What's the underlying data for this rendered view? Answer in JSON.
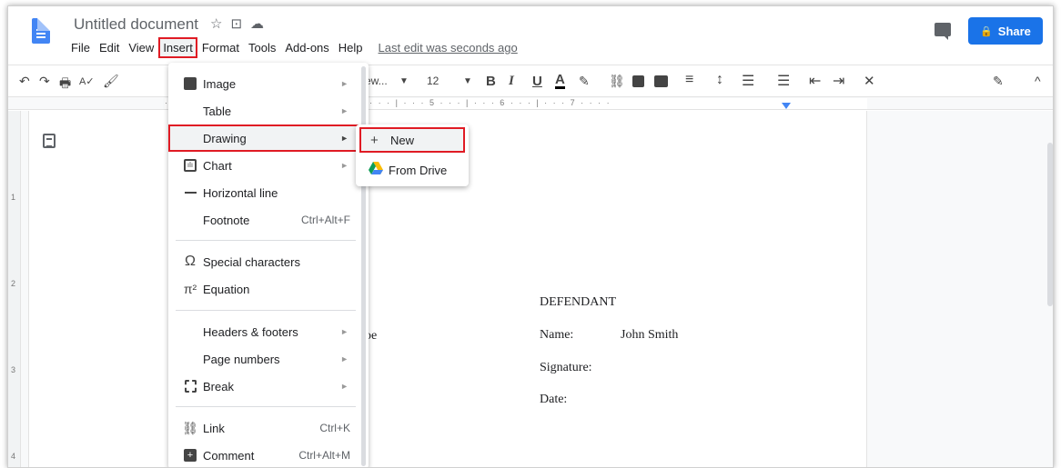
{
  "header": {
    "doc_title": "Untitled document",
    "title_icons": [
      "star-icon",
      "folder-icon",
      "cloud-icon"
    ],
    "menus": [
      "File",
      "Edit",
      "View",
      "Insert",
      "Format",
      "Tools",
      "Add-ons",
      "Help"
    ],
    "last_edit": "Last edit was seconds ago",
    "share_label": "Share",
    "share_icon": "🔒"
  },
  "toolbar": {
    "undo": "↶",
    "redo": "↷",
    "print": "🖶",
    "spell": "A✓",
    "paint": "🖌",
    "font_partial": "ew...",
    "font_size": "12",
    "bold": "B",
    "italic": "I",
    "underline": "U",
    "text_color": "A",
    "highlight": "✎",
    "link": "⛓",
    "edit": "✎",
    "collapse": "^"
  },
  "ruler": {
    "ticks": "· · 1 · · · 2 · · · | · · · 3 · · · | · · · 4 · · · | · · · 5 · · · | · · · 6 · · · | · · · 7 · · · ·"
  },
  "vruler": {
    "marks": [
      "1",
      "2",
      "3",
      "4"
    ]
  },
  "document": {
    "defendant_heading": "DEFENDANT",
    "name_label": "Name:",
    "name_value": "John Smith",
    "signature_label": "Signature:",
    "date_label": "Date:",
    "partial_left": "oe"
  },
  "insert_menu": {
    "items": [
      {
        "label": "Image",
        "icon": "image-icon",
        "submenu": true
      },
      {
        "label": "Table",
        "icon": "",
        "submenu": true
      },
      {
        "label": "Drawing",
        "icon": "",
        "submenu": true
      },
      {
        "label": "Chart",
        "icon": "chart-icon",
        "submenu": true
      },
      {
        "label": "Horizontal line",
        "icon": "horizontal-line-icon",
        "submenu": false
      },
      {
        "label": "Footnote",
        "icon": "",
        "shortcut": "Ctrl+Alt+F"
      },
      {
        "label": "Special characters",
        "icon": "omega-icon",
        "submenu": false
      },
      {
        "label": "Equation",
        "icon": "pi-icon",
        "submenu": false
      },
      {
        "label": "Headers & footers",
        "icon": "",
        "submenu": true
      },
      {
        "label": "Page numbers",
        "icon": "",
        "submenu": true
      },
      {
        "label": "Break",
        "icon": "break-icon",
        "submenu": true
      },
      {
        "label": "Link",
        "icon": "link-icon",
        "shortcut": "Ctrl+K"
      },
      {
        "label": "Comment",
        "icon": "comment-icon",
        "shortcut": "Ctrl+Alt+M"
      }
    ],
    "arrow": "►",
    "omega": "Ω",
    "pi": "π²"
  },
  "drawing_submenu": {
    "items": [
      {
        "label": "New",
        "icon": "+"
      },
      {
        "label": "From Drive",
        "icon": "drive-icon"
      }
    ]
  },
  "colors": {
    "highlight_border": "#e01b24",
    "share_blue": "#1a73e8",
    "docs_blue": "#4285f4"
  }
}
